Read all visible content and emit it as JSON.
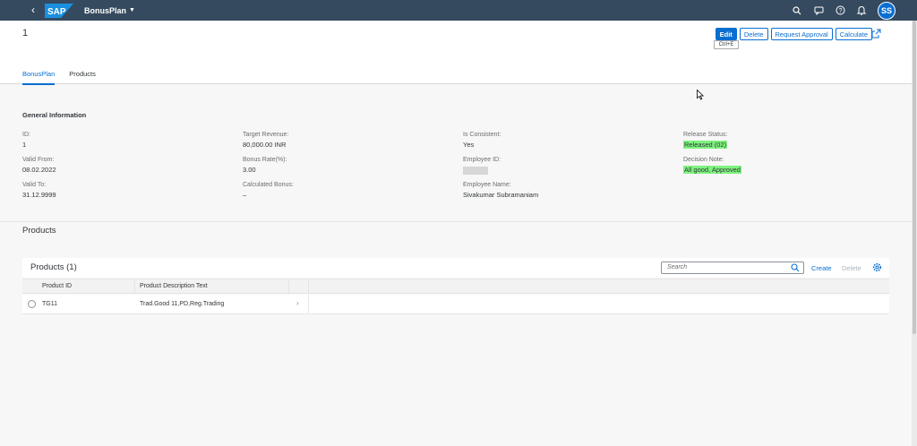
{
  "shell": {
    "logo_text": "SAP",
    "app_title": "BonusPlan",
    "user_initials": "SS",
    "brand_color": "#0a6ed1",
    "icons": [
      "search-icon",
      "feedback-icon",
      "help-icon",
      "bell-icon"
    ]
  },
  "header": {
    "object_title": "1",
    "actions": {
      "edit": "Edit",
      "delete": "Delete",
      "request_approval": "Request Approval",
      "calculate": "Calculate"
    },
    "tooltip": "Ctrl+E",
    "tabs": [
      "BonusPlan",
      "Products"
    ]
  },
  "general": {
    "title": "General Information",
    "id_label": "ID:",
    "id_value": "1",
    "valid_from_label": "Valid From:",
    "valid_from_value": "08.02.2022",
    "valid_to_label": "Valid To:",
    "valid_to_value": "31.12.9999",
    "target_revenue_label": "Target Revenue:",
    "target_revenue_value": "80,000.00  INR",
    "bonus_rate_label": "Bonus Rate(%):",
    "bonus_rate_value": "3.00",
    "calculated_bonus_label": "Calculated Bonus:",
    "calculated_bonus_value": "–",
    "is_consistent_label": "Is Consistent:",
    "is_consistent_value": "Yes",
    "employee_id_label": "Employee ID:",
    "employee_name_label": "Employee Name:",
    "employee_name_value": "Sivakumar Subramaniam",
    "release_status_label": "Release Status:",
    "release_status_value": "Released (02)",
    "decision_note_label": "Decision Note:",
    "decision_note_value": "All good, Approved",
    "highlight_color": "#7ef27e"
  },
  "products": {
    "section_title": "Products",
    "table_title": "Products (1)",
    "search_placeholder": "Search",
    "create_label": "Create",
    "delete_label": "Delete",
    "columns": [
      "Product ID",
      "Product Description Text"
    ],
    "rows": [
      {
        "product_id": "TG11",
        "description": "Trad.Good 11,PD,Reg.Trading"
      }
    ]
  }
}
